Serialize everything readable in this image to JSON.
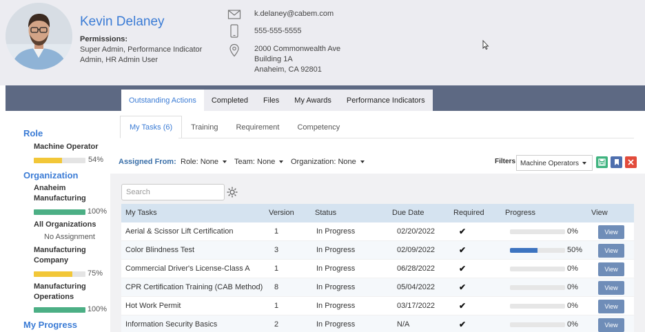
{
  "profile": {
    "name": "Kevin Delaney",
    "permissions_label": "Permissions:",
    "permissions_value": "Super Admin, Performance Indicator Admin, HR Admin User",
    "email": "k.delaney@cabem.com",
    "phone": "555-555-5555",
    "address_line1": "2000 Commonwealth Ave",
    "address_line2": "Building 1A",
    "address_line3": "Anaheim, CA 92801",
    "icons": [
      "envelope-icon",
      "mobile-phone-icon",
      "location-pin-icon"
    ]
  },
  "main_tabs": [
    {
      "label": "Outstanding Actions",
      "active": true
    },
    {
      "label": "Completed",
      "active": false
    },
    {
      "label": "Files",
      "active": false
    },
    {
      "label": "My Awards",
      "active": false
    },
    {
      "label": "Performance Indicators",
      "active": false
    }
  ],
  "sidebar": {
    "role_title": "Role",
    "role_item": "Machine Operator",
    "role_pct": "54%",
    "role_progress": 0.54,
    "org_title": "Organization",
    "orgs": [
      {
        "label": "Anaheim Manufacturing",
        "pct": "100%",
        "progress": 1.0
      },
      {
        "label": "All Organizations",
        "note": "No Assignment"
      },
      {
        "label": "Manufacturing Company",
        "pct": "75%",
        "progress": 0.75
      },
      {
        "label": "Manufacturing Operations",
        "pct": "100%",
        "progress": 1.0
      }
    ],
    "progress_title": "My Progress"
  },
  "sub_tabs": [
    {
      "label": "My Tasks (6)",
      "active": true
    },
    {
      "label": "Training",
      "active": false
    },
    {
      "label": "Requirement",
      "active": false
    },
    {
      "label": "Competency",
      "active": false
    }
  ],
  "filters_row": {
    "assigned_from_label": "Assigned From:",
    "role": "Role: None",
    "team": "Team: None",
    "organization": "Organization: None",
    "filters_label": "Filters",
    "filter_value": "Machine Operators"
  },
  "search": {
    "placeholder": "Search"
  },
  "table": {
    "headers": {
      "task": "My Tasks",
      "version": "Version",
      "status": "Status",
      "due": "Due Date",
      "required": "Required",
      "progress": "Progress",
      "view": "View"
    },
    "rows": [
      {
        "task": "Aerial & Scissor Lift Certification",
        "version": "1",
        "status": "In Progress",
        "due": "02/20/2022",
        "required": "✔",
        "progress": 0,
        "pct": "0%",
        "view": "View"
      },
      {
        "task": "Color Blindness Test",
        "version": "3",
        "status": "In Progress",
        "due": "02/09/2022",
        "required": "✔",
        "progress": 0.5,
        "pct": "50%",
        "view": "View"
      },
      {
        "task": "Commercial Driver's License-Class A",
        "version": "1",
        "status": "In Progress",
        "due": "06/28/2022",
        "required": "✔",
        "progress": 0,
        "pct": "0%",
        "view": "View"
      },
      {
        "task": "CPR Certification Training (CAB Method)",
        "version": "8",
        "status": "In Progress",
        "due": "05/04/2022",
        "required": "✔",
        "progress": 0,
        "pct": "0%",
        "view": "View"
      },
      {
        "task": "Hot Work Permit",
        "version": "1",
        "status": "In Progress",
        "due": "03/17/2022",
        "required": "✔",
        "progress": 0,
        "pct": "0%",
        "view": "View"
      },
      {
        "task": "Information Security Basics",
        "version": "2",
        "status": "In Progress",
        "due": "N/A",
        "required": "✔",
        "progress": 0,
        "pct": "0%",
        "view": "View"
      }
    ]
  },
  "colors": {
    "accent_blue": "#3a7bd5",
    "header_band": "#5d6983",
    "progress_yellow": "#f2c738",
    "progress_green": "#4caf85",
    "task_progress_blue": "#3d74c0",
    "save_green": "#3fb37f",
    "bookmark_blue": "#4e6fae",
    "clear_red": "#e24b3b"
  }
}
